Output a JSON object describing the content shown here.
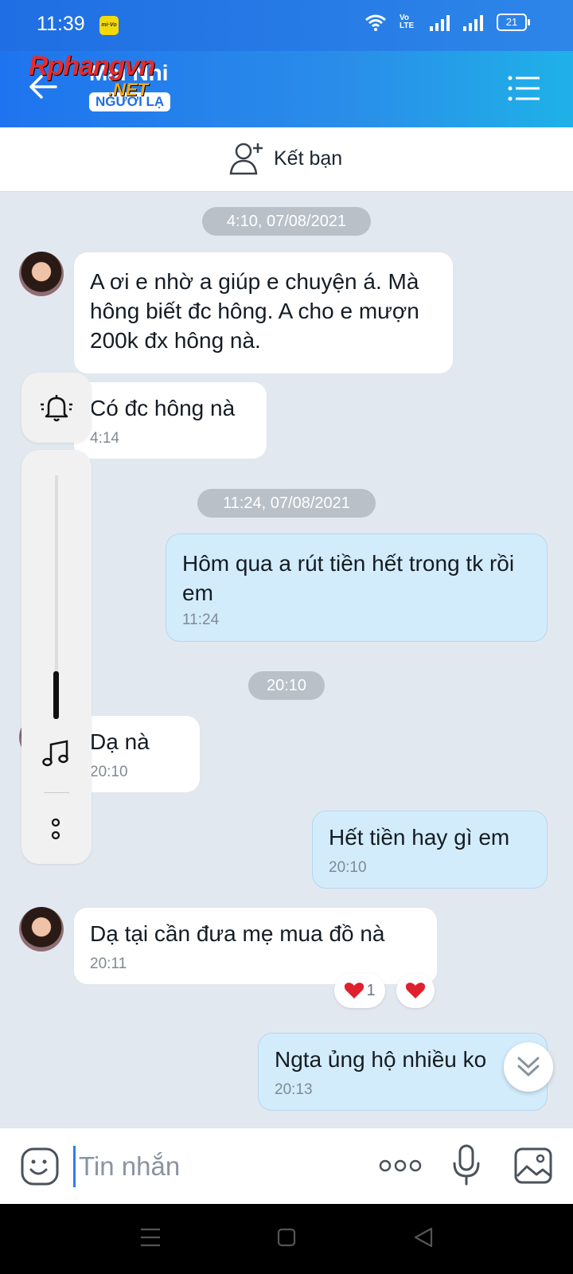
{
  "status_bar": {
    "time": "11:39",
    "carrier_badge": "mi·Vo",
    "volte": "Vo LTE",
    "battery": "21"
  },
  "header": {
    "contact_name": "Mai Nhi",
    "stranger_badge": "NGƯỜI LẠ",
    "watermark_main": "Rphangvn",
    "watermark_sub": ".NET"
  },
  "add_friend": {
    "label": "Kết bạn"
  },
  "messages": {
    "date1": "4:10, 07/08/2021",
    "m1_text": "A ơi e nhờ a giúp e chuyện á. Mà hông biết đc hông. A cho e mượn 200k đx hông nà.",
    "m2_text": "Có đc hông nà",
    "m2_time": "4:14",
    "date2": "11:24, 07/08/2021",
    "m3_text": "Hôm qua a rút tiền hết trong tk rồi em",
    "m3_time": "11:24",
    "date3": "20:10",
    "m4_text": "Dạ nà",
    "m4_time": "20:10",
    "m5_text": "Hết tiền hay gì em",
    "m5_time": "20:10",
    "m6_text": "Dạ tại cần đưa mẹ mua đồ nà",
    "m6_time": "20:11",
    "m6_reaction_count": "1",
    "m7_text": "Ngta ủng hộ nhiều ko",
    "m7_time": "20:13"
  },
  "composer": {
    "placeholder": "Tin nhắn"
  },
  "colors": {
    "header_blue": "#1e74ee",
    "out_bubble": "#d3ecfb",
    "in_bubble": "#ffffff",
    "chat_bg": "#e2e8f0",
    "reaction_heart": "#e0202c"
  },
  "icons": [
    "back-arrow-icon",
    "list-menu-icon",
    "add-person-icon",
    "bell-icon",
    "music-note-icon",
    "more-vertical-icon",
    "chevron-double-down-icon",
    "emoji-icon",
    "more-horizontal-icon",
    "microphone-icon",
    "image-icon",
    "heart-icon"
  ]
}
